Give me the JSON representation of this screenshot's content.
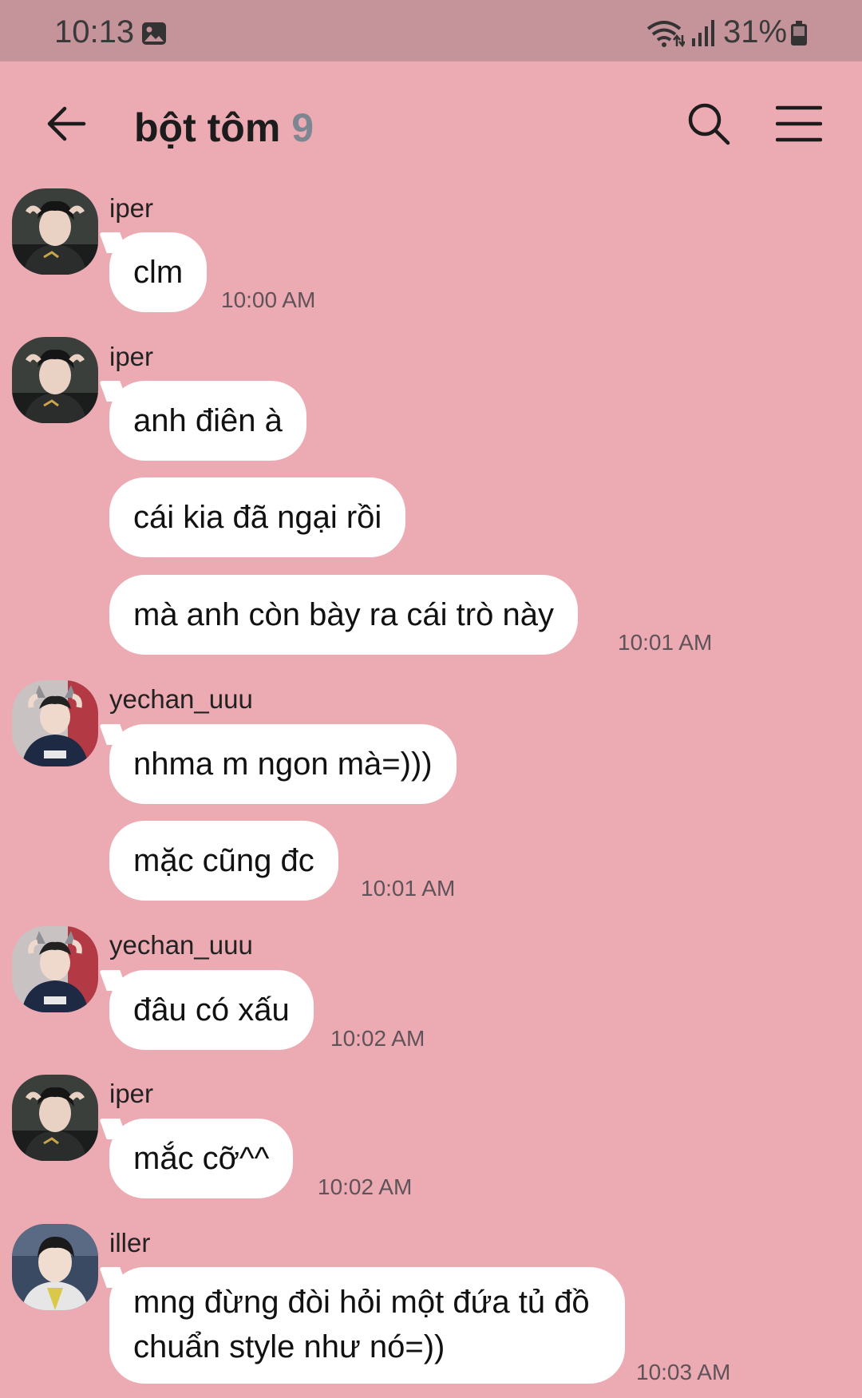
{
  "status_bar": {
    "time": "10:13",
    "battery": "31%",
    "icons": [
      "gallery-icon",
      "wifi-icon",
      "signal-icon",
      "battery-icon"
    ]
  },
  "header": {
    "title": "bột tôm",
    "member_count": "9",
    "icons": [
      "back-arrow-icon",
      "search-icon",
      "menu-icon"
    ]
  },
  "colors": {
    "background": "#ECAAB3",
    "status_bar": "#C5939A",
    "bubble": "#FFFFFF",
    "member_count": "#7D8791"
  },
  "messages": [
    {
      "sender": "iper",
      "bubbles": [
        "clm"
      ],
      "time": "10:00 AM"
    },
    {
      "sender": "iper",
      "bubbles": [
        "anh điên à",
        "cái kia đã ngại rồi",
        "mà anh còn bày ra cái trò này"
      ],
      "time": "10:01 AM"
    },
    {
      "sender": "yechan_uuu",
      "bubbles": [
        "nhma m ngon mà=)))",
        "mặc cũng đc"
      ],
      "time": "10:01 AM"
    },
    {
      "sender": "yechan_uuu",
      "bubbles": [
        "đâu có xấu"
      ],
      "time": "10:02 AM"
    },
    {
      "sender": "iper",
      "bubbles": [
        "mắc cỡ^^"
      ],
      "time": "10:02 AM"
    },
    {
      "sender": "iller",
      "bubbles": [
        "mng đừng đòi hỏi một đứa tủ đồ chuẩn style như nó=))"
      ],
      "time": "10:03 AM"
    }
  ]
}
